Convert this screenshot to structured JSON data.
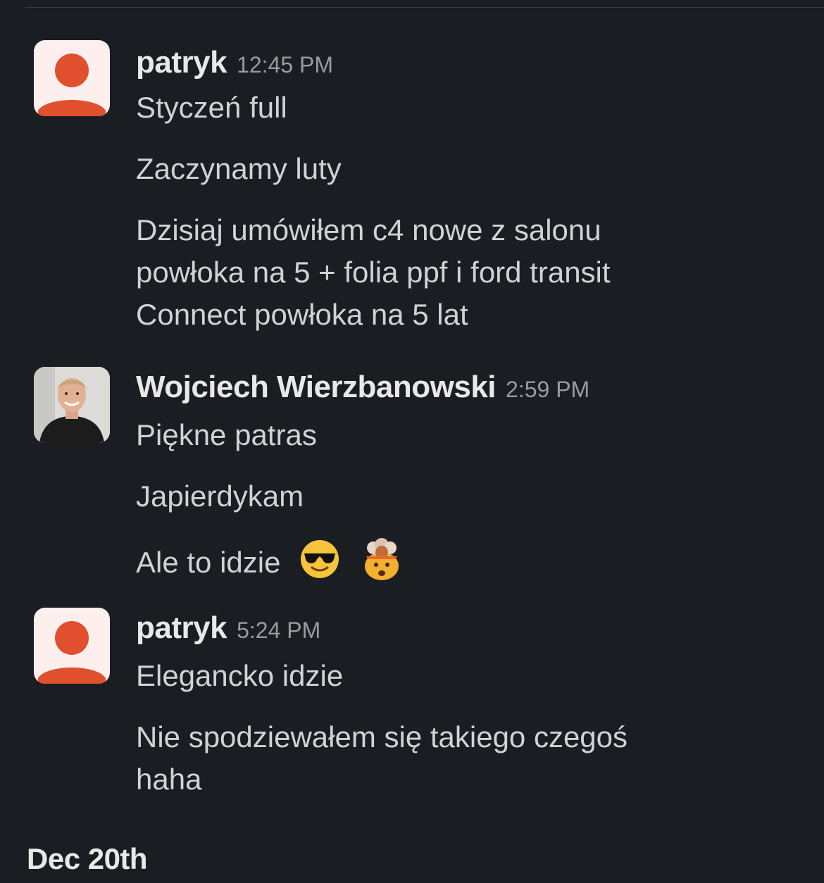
{
  "messages": [
    {
      "author": "patryk",
      "time": "12:45 PM",
      "avatar": "default-avatar-icon",
      "lines": [
        "Styczeń full",
        "Zaczynamy luty"
      ],
      "paragraph": [
        "Dzisiaj umówiłem c4 nowe z salonu",
        "powłoka na 5 + folia ppf i ford transit",
        "Connect powłoka na 5 lat"
      ]
    },
    {
      "author": "Wojciech Wierzbanowski",
      "time": "2:59 PM",
      "avatar": "profile-photo",
      "lines": [
        "Piękne patras",
        "Japierdykam",
        "Ale to idzie"
      ],
      "emojis": [
        "sunglasses-emoji",
        "exploding-head-emoji"
      ]
    },
    {
      "author": "patryk",
      "time": "5:24 PM",
      "avatar": "default-avatar-icon",
      "lines": [
        "Elegancko idzie"
      ],
      "paragraph": [
        "Nie spodziewałem się takiego czegoś",
        "haha"
      ]
    }
  ],
  "date_divider": "Dec 20th",
  "colors": {
    "background": "#1a1d21",
    "avatar_accent": "#e0502e",
    "avatar_bg": "#fcefed",
    "text": "#d1d2d3",
    "author": "#e8e8e8",
    "timestamp": "#9a9b9d"
  }
}
